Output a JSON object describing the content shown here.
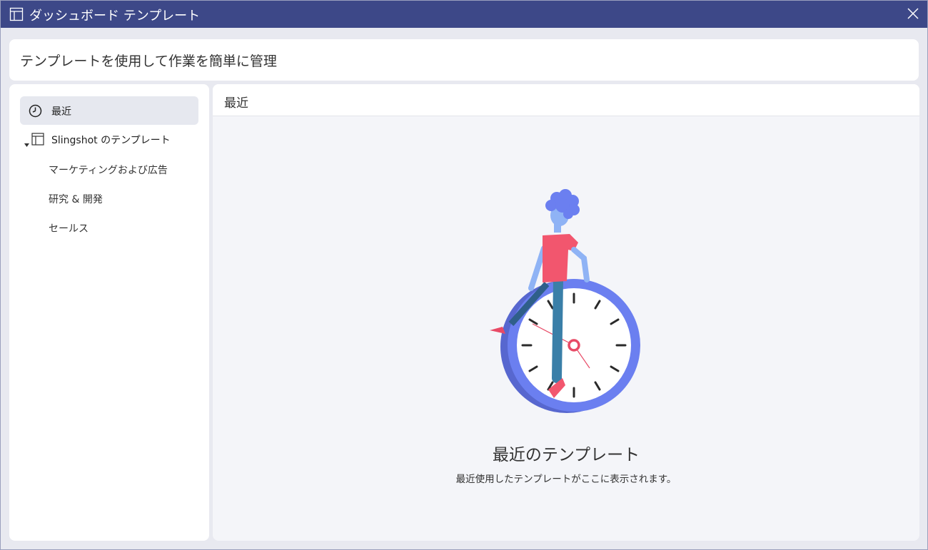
{
  "window": {
    "title": "ダッシュボード テンプレート",
    "colors": {
      "titlebar": "#3d4888",
      "accent": "#6b7ff0",
      "figure_shirt": "#f2566e"
    }
  },
  "header": {
    "subtitle": "テンプレートを使用して作業を簡単に管理"
  },
  "sidebar": {
    "recent": {
      "label": "最近",
      "icon": "clock-icon"
    },
    "group": {
      "label": "Slingshot のテンプレート",
      "icon": "template-icon",
      "expanded": true,
      "children": [
        {
          "label": "マーケティングおよび広告"
        },
        {
          "label": "研究 & 開発"
        },
        {
          "label": "セールス"
        }
      ]
    }
  },
  "main": {
    "title": "最近",
    "empty": {
      "title": "最近のテンプレート",
      "description": "最近使用したテンプレートがここに表示されます。"
    }
  }
}
